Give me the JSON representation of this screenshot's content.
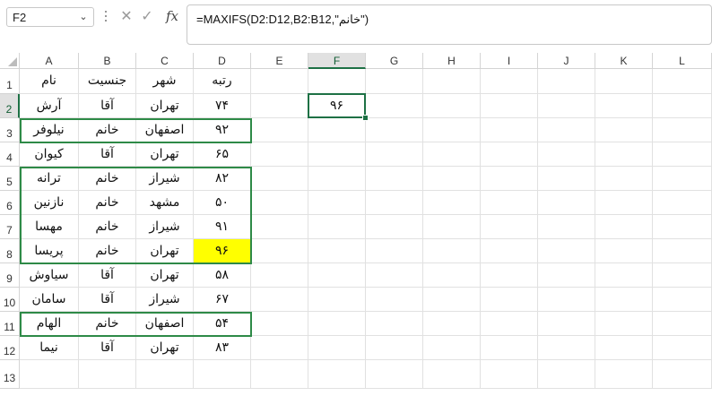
{
  "name_box": {
    "value": "F2"
  },
  "formula_bar": {
    "cancel_icon": "✕",
    "enter_icon": "✓",
    "fx_label": "fx",
    "formula": "=MAXIFS(D2:D12,B2:B12,\"خانم\")"
  },
  "columns": [
    "A",
    "B",
    "C",
    "D",
    "E",
    "F",
    "G",
    "H",
    "I",
    "J",
    "K",
    "L"
  ],
  "rows": [
    "1",
    "2",
    "3",
    "4",
    "5",
    "6",
    "7",
    "8",
    "9",
    "10",
    "11",
    "12",
    "13"
  ],
  "selected_cell": "F2",
  "cells": {
    "A1": "نام",
    "B1": "جنسیت",
    "C1": "شهر",
    "D1": "رتبه",
    "A2": "آرش",
    "B2": "آقا",
    "C2": "تهران",
    "D2": "۷۴",
    "F2": "۹۶",
    "A3": "نیلوفر",
    "B3": "خانم",
    "C3": "اصفهان",
    "D3": "۹۲",
    "A4": "کیوان",
    "B4": "آقا",
    "C4": "تهران",
    "D4": "۶۵",
    "A5": "ترانه",
    "B5": "خانم",
    "C5": "شیراز",
    "D5": "۸۲",
    "A6": "نازنین",
    "B6": "خانم",
    "C6": "مشهد",
    "D6": "۵۰",
    "A7": "مهسا",
    "B7": "خانم",
    "C7": "شیراز",
    "D7": "۹۱",
    "A8": "پریسا",
    "B8": "خانم",
    "C8": "تهران",
    "D8": "۹۶",
    "A9": "سیاوش",
    "B9": "آقا",
    "C9": "تهران",
    "D9": "۵۸",
    "A10": "سامان",
    "B10": "آقا",
    "C10": "شیراز",
    "D10": "۶۷",
    "A11": "الهام",
    "B11": "خانم",
    "C11": "اصفهان",
    "D11": "۵۴",
    "A12": "نیما",
    "B12": "آقا",
    "C12": "تهران",
    "D12": "۸۳"
  },
  "highlighted_cells": [
    "D8"
  ],
  "outlined_ranges": [
    "A3:D3",
    "A5:D8",
    "A11:D11"
  ],
  "colors": {
    "highlight": "#ffff00",
    "outline": "#2e8a47",
    "selection": "#1e7145"
  }
}
